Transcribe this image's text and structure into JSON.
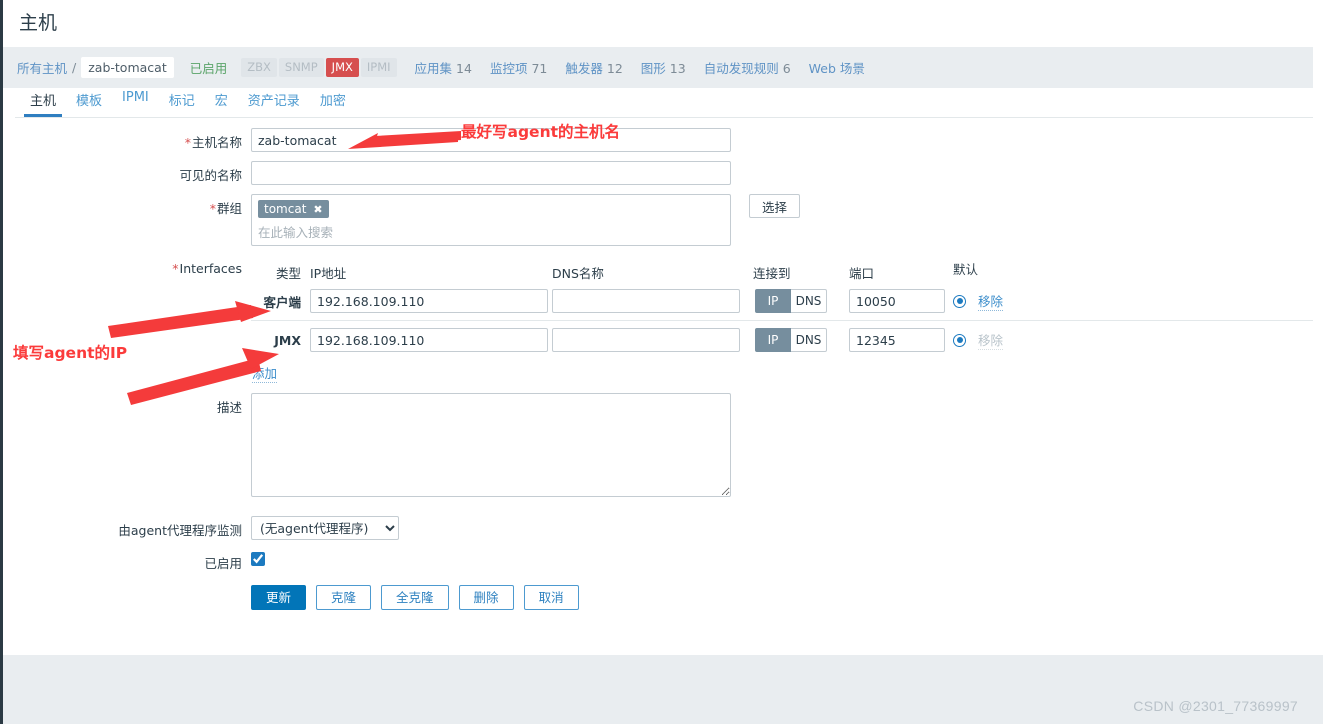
{
  "page": {
    "title": "主机"
  },
  "breadcrumb": {
    "all_hosts": "所有主机",
    "separator": "/",
    "current": "zab-tomacat",
    "status": "已启用",
    "protocols": [
      {
        "label": "ZBX",
        "active": false
      },
      {
        "label": "SNMP",
        "active": false
      },
      {
        "label": "JMX",
        "active": true
      },
      {
        "label": "IPMI",
        "active": false
      }
    ],
    "items": [
      {
        "label": "应用集",
        "count": "14"
      },
      {
        "label": "监控项",
        "count": "71"
      },
      {
        "label": "触发器",
        "count": "12"
      },
      {
        "label": "图形",
        "count": "13"
      },
      {
        "label": "自动发现规则",
        "count": "6"
      },
      {
        "label": "Web 场景",
        "count": ""
      }
    ]
  },
  "tabs": [
    {
      "label": "主机",
      "active": true
    },
    {
      "label": "模板",
      "active": false
    },
    {
      "label": "IPMI",
      "active": false
    },
    {
      "label": "标记",
      "active": false
    },
    {
      "label": "宏",
      "active": false
    },
    {
      "label": "资产记录",
      "active": false
    },
    {
      "label": "加密",
      "active": false
    }
  ],
  "form": {
    "host_name": {
      "label": "主机名称",
      "required": true,
      "value": "zab-tomacat",
      "placeholder": ""
    },
    "visible_name": {
      "label": "可见的名称",
      "required": false,
      "value": "",
      "placeholder": ""
    },
    "groups": {
      "label": "群组",
      "required": true,
      "tags": [
        {
          "name": "tomcat",
          "remove": "✖"
        }
      ],
      "placeholder": "在此输入搜索",
      "select_button": "选择"
    },
    "interfaces": {
      "label": "Interfaces",
      "required": true,
      "headers": {
        "type": "类型",
        "ip": "IP地址",
        "dns": "DNS名称",
        "connect_to": "连接到",
        "port": "端口",
        "default": "默认"
      },
      "rows": [
        {
          "type": "客户端",
          "ip": "192.168.109.110",
          "dns": "",
          "connect_ip": "IP",
          "connect_dns": "DNS",
          "connect_selected": "IP",
          "port": "10050",
          "is_default": true,
          "remove_label": "移除",
          "remove_disabled": false
        },
        {
          "type": "JMX",
          "ip": "192.168.109.110",
          "dns": "",
          "connect_ip": "IP",
          "connect_dns": "DNS",
          "connect_selected": "IP",
          "port": "12345",
          "is_default": true,
          "remove_label": "移除",
          "remove_disabled": true
        }
      ],
      "add_label": "添加"
    },
    "description": {
      "label": "描述",
      "value": "",
      "placeholder": ""
    },
    "monitored_by_proxy": {
      "label": "由agent代理程序监测",
      "selected": "(无agent代理程序)",
      "options": [
        "(无agent代理程序)"
      ]
    },
    "enabled": {
      "label": "已启用",
      "checked": true
    },
    "buttons": [
      {
        "label": "更新",
        "style": "primary"
      },
      {
        "label": "克隆",
        "style": "secondary"
      },
      {
        "label": "全克隆",
        "style": "secondary"
      },
      {
        "label": "删除",
        "style": "secondary"
      },
      {
        "label": "取消",
        "style": "secondary"
      }
    ]
  },
  "annotations": [
    {
      "id": "anno1",
      "text": "最好写agent的主机名"
    },
    {
      "id": "anno2",
      "text": "填写agent的IP"
    }
  ],
  "watermark": "CSDN @2301_77369997",
  "colors": {
    "accent": "#0275b8",
    "link": "#4d9ad0",
    "danger": "#d64f4f",
    "annotation": "#fb3b3b",
    "bar_bg": "#e9edf0",
    "tag_bg": "#768e9e"
  }
}
